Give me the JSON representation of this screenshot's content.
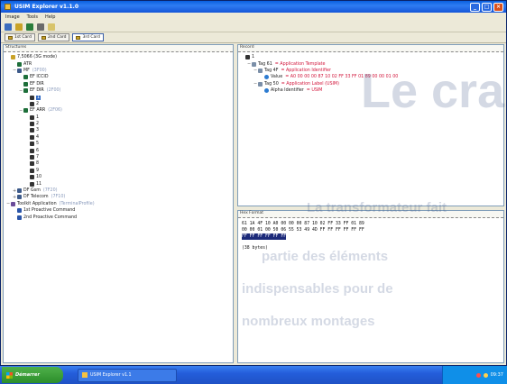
{
  "window": {
    "title": "USIM Explorer v1.1.0",
    "controls": {
      "minimize": "_",
      "maximize": "□",
      "close": "×"
    }
  },
  "menu": [
    "Image",
    "Tools",
    "Help"
  ],
  "toolbar": [
    "open-icon",
    "settings-icon",
    "save-icon",
    "print-icon",
    "help-icon"
  ],
  "cards": [
    {
      "label": "1st Card",
      "active": false
    },
    {
      "label": "2nd Card",
      "active": false
    },
    {
      "label": "3rd Card",
      "active": true
    }
  ],
  "left_pane": {
    "header": "Structures",
    "tree": [
      {
        "indent": 0,
        "exp": "",
        "icon": "mf",
        "label": "7,5066 (3G mode)",
        "note": ""
      },
      {
        "indent": 1,
        "exp": "",
        "icon": "ef",
        "label": "ATR",
        "note": ""
      },
      {
        "indent": 1,
        "exp": "−",
        "icon": "df",
        "label": "MF",
        "note": "(3F00)"
      },
      {
        "indent": 2,
        "exp": "",
        "icon": "ef",
        "label": "EF ICCID",
        "note": ""
      },
      {
        "indent": 2,
        "exp": "",
        "icon": "ef",
        "label": "EF DIR",
        "note": ""
      },
      {
        "indent": 2,
        "exp": "−",
        "icon": "ef",
        "label": "EF DIR",
        "note": "(2F00)"
      },
      {
        "indent": 3,
        "exp": "",
        "icon": "rec",
        "label": "1",
        "note": "",
        "selected": true
      },
      {
        "indent": 3,
        "exp": "",
        "icon": "rec",
        "label": "2",
        "note": ""
      },
      {
        "indent": 2,
        "exp": "−",
        "icon": "ef",
        "label": "EF ARR",
        "note": "(2F06)"
      },
      {
        "indent": 3,
        "exp": "",
        "icon": "rec",
        "label": "1",
        "note": ""
      },
      {
        "indent": 3,
        "exp": "",
        "icon": "rec",
        "label": "2",
        "note": ""
      },
      {
        "indent": 3,
        "exp": "",
        "icon": "rec",
        "label": "3",
        "note": ""
      },
      {
        "indent": 3,
        "exp": "",
        "icon": "rec",
        "label": "4",
        "note": ""
      },
      {
        "indent": 3,
        "exp": "",
        "icon": "rec",
        "label": "5",
        "note": ""
      },
      {
        "indent": 3,
        "exp": "",
        "icon": "rec",
        "label": "6",
        "note": ""
      },
      {
        "indent": 3,
        "exp": "",
        "icon": "rec",
        "label": "7",
        "note": ""
      },
      {
        "indent": 3,
        "exp": "",
        "icon": "rec",
        "label": "8",
        "note": ""
      },
      {
        "indent": 3,
        "exp": "",
        "icon": "rec",
        "label": "9",
        "note": ""
      },
      {
        "indent": 3,
        "exp": "",
        "icon": "rec",
        "label": "10",
        "note": ""
      },
      {
        "indent": 3,
        "exp": "",
        "icon": "rec",
        "label": "11",
        "note": ""
      },
      {
        "indent": 1,
        "exp": "+",
        "icon": "df",
        "label": "DF Gsm",
        "note": "(7F20)"
      },
      {
        "indent": 1,
        "exp": "+",
        "icon": "df",
        "label": "DF Telecom",
        "note": "(7F10)"
      },
      {
        "indent": 0,
        "exp": "−",
        "icon": "app",
        "label": "Toolkit Application",
        "note": "(TerminalProfile)"
      },
      {
        "indent": 1,
        "exp": "",
        "icon": "cmd",
        "label": "1st Proactive Command",
        "note": ""
      },
      {
        "indent": 1,
        "exp": "",
        "icon": "cmd",
        "label": "2nd Proactive Command",
        "note": ""
      }
    ]
  },
  "right_top": {
    "header": "Record",
    "tree": [
      {
        "indent": 0,
        "exp": "",
        "icon": "rec",
        "label": "1",
        "note": "",
        "note_class": ""
      },
      {
        "indent": 1,
        "exp": "−",
        "icon": "tag",
        "label": "Tag 61",
        "note": "= Application Template",
        "note_class": "red"
      },
      {
        "indent": 2,
        "exp": "−",
        "icon": "tag",
        "label": "Tag 4F",
        "note": "= Application Identifier",
        "note_class": "red"
      },
      {
        "indent": 3,
        "exp": "",
        "icon": "val",
        "label": "Value",
        "note": "= A0 00 00 00 87 10 02 FF 33 FF 01 89 00 00 01 00",
        "note_class": "red"
      },
      {
        "indent": 2,
        "exp": "−",
        "icon": "tag",
        "label": "Tag 50",
        "note": "= Application Label (USIM)",
        "note_class": "red"
      },
      {
        "indent": 3,
        "exp": "",
        "icon": "val",
        "label": "Alpha Identifier",
        "note": "= USIM",
        "note_class": "red"
      }
    ]
  },
  "right_bottom": {
    "header": "Hex Format",
    "hex_rows": [
      "61 1A 4F 10 A0 00 00 00 87 10 02 FF 33 FF 01 89",
      "00 00 01 00 50 06 55 53 49 4D FF FF FF FF FF FF",
      "FF FF FF FF FF FF"
    ],
    "bytes": "(38 bytes)"
  },
  "taskbar": {
    "start": "Démarrer",
    "task": "USIM Explorer v1.1",
    "clock": "09:37"
  },
  "magazine_overlay": {
    "words": [
      "Le cran",
      "La transformateur fait",
      "partie des éléments",
      "indispensables pour de",
      "nombreux montages"
    ]
  }
}
